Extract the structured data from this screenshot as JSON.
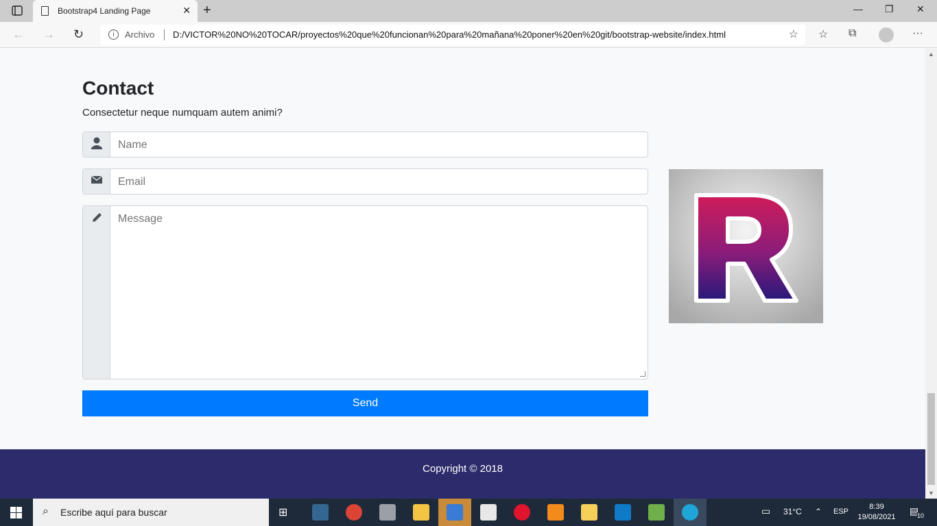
{
  "browser": {
    "tab_title": "Bootstrap4 Landing Page",
    "address_prefix": "Archivo",
    "url": "D:/VICTOR%20NO%20TOCAR/proyectos%20que%20funcionan%20para%20mañana%20poner%20en%20git/bootstrap-website/index.html"
  },
  "contact": {
    "title": "Contact",
    "subtitle": "Consectetur neque numquam autem animi?",
    "name_placeholder": "Name",
    "email_placeholder": "Email",
    "message_placeholder": "Message",
    "send_label": "Send"
  },
  "footer": {
    "copyright": "Copyright © 2018"
  },
  "taskbar": {
    "search_placeholder": "Escribe aquí para buscar",
    "temperature": "31°C",
    "language": "ESP",
    "time": "8:39",
    "date": "19/08/2021",
    "notifications": "10"
  },
  "colors": {
    "primary": "#007bff",
    "footer_bg": "#2c2c6c",
    "logo_top": "#c81b5e",
    "logo_bottom": "#2e1a7a"
  }
}
